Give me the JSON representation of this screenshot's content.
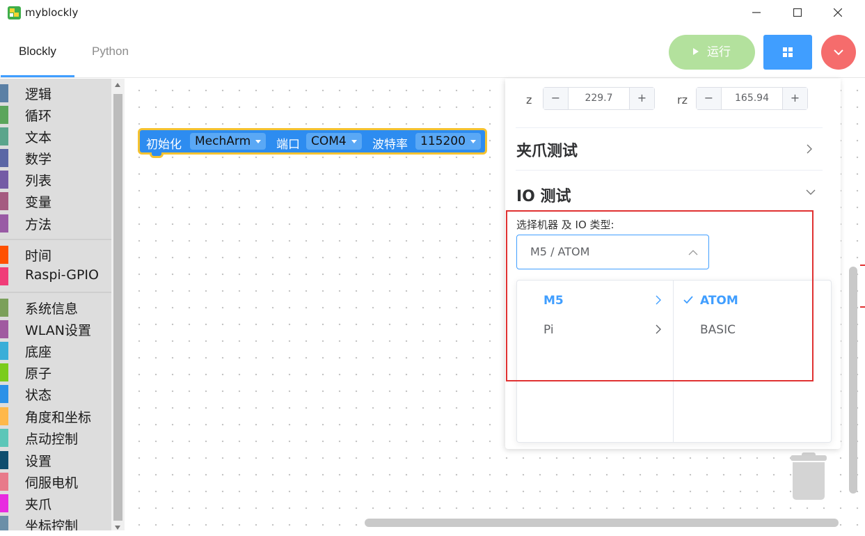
{
  "window": {
    "title": "myblockly"
  },
  "tabs": [
    {
      "label": "Blockly"
    },
    {
      "label": "Python"
    }
  ],
  "actions": {
    "run_label": "运行"
  },
  "toolbox": {
    "categories": [
      {
        "label": "逻辑",
        "color": "#5b80a5"
      },
      {
        "label": "循环",
        "color": "#5ba55b"
      },
      {
        "label": "文本",
        "color": "#5ba58c"
      },
      {
        "label": "数学",
        "color": "#5b67a5"
      },
      {
        "label": "列表",
        "color": "#745ba5"
      },
      {
        "label": "变量",
        "color": "#a55b80"
      },
      {
        "label": "方法",
        "color": "#995ba5"
      },
      {
        "label": "时间",
        "color": "#ff5000"
      },
      {
        "label": "Raspi-GPIO",
        "color": "#f03c78"
      },
      {
        "label": "系统信息",
        "color": "#7ba05a"
      },
      {
        "label": "WLAN设置",
        "color": "#a05aa0"
      },
      {
        "label": "底座",
        "color": "#3aaed8"
      },
      {
        "label": "原子",
        "color": "#7acc1c"
      },
      {
        "label": "状态",
        "color": "#2b91e8"
      },
      {
        "label": "角度和坐标",
        "color": "#ffb84a"
      },
      {
        "label": "点动控制",
        "color": "#5cc6b8"
      },
      {
        "label": "设置",
        "color": "#0e4d6e"
      },
      {
        "label": "伺服电机",
        "color": "#e87a8a"
      },
      {
        "label": "夹爪",
        "color": "#e82be0"
      },
      {
        "label": "坐标控制",
        "color": "#6b8fa8"
      }
    ]
  },
  "block": {
    "init_label": "初始化",
    "robot_value": "MechArm",
    "port_label": "端口",
    "port_value": "COM4",
    "baud_label": "波特率",
    "baud_value": "115200"
  },
  "panel": {
    "z": {
      "label": "z",
      "value": "229.7"
    },
    "rz": {
      "label": "rz",
      "value": "165.94"
    },
    "stepper_minus": "−",
    "stepper_plus": "+",
    "gripper_section": "夹爪测试",
    "io_section": "IO 测试",
    "io_field_label": "选择机器 及 IO 类型:",
    "io_select_value": "M5 / ATOM",
    "cascader": {
      "level1": [
        {
          "label": "M5",
          "active": true
        },
        {
          "label": "Pi",
          "active": false
        }
      ],
      "level2": [
        {
          "label": "ATOM",
          "selected": true
        },
        {
          "label": "BASIC",
          "selected": false
        }
      ]
    }
  },
  "colors": {
    "accent": "#409eff",
    "run_button": "#b3e19d",
    "menu_button": "#f56c6c",
    "block_fill": "#2d8cf0",
    "block_outline": "#f5c230",
    "highlight_box": "#e03131"
  },
  "icons": {
    "min": "minimize-icon",
    "max": "maximize-icon",
    "close": "close-icon",
    "run": "play-icon",
    "grid": "grid-icon",
    "menu": "chevron-down-icon",
    "trash": "trash-icon",
    "check": "check-icon"
  }
}
